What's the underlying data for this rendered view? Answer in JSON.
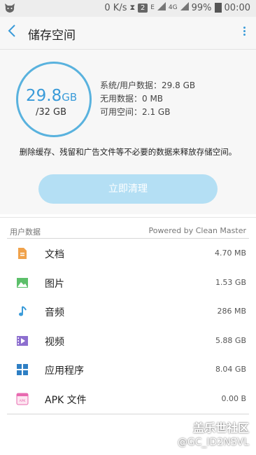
{
  "status_bar": {
    "net_speed": "0 K/s",
    "sim": "2",
    "net_e": "E",
    "net_4g": "4G",
    "battery": "99%",
    "time": "00:00"
  },
  "header": {
    "title": "储存空间"
  },
  "summary": {
    "used": "29.8",
    "used_unit": "GB",
    "total": "/32 GB",
    "stats": [
      "系统/用户数据：29.8 GB",
      "无用数据：0 MB",
      "可用空间：2.1 GB"
    ],
    "description": "删除缓存、残留和广告文件等不必要的数据来释放存储空间。",
    "clean_button": "立即清理"
  },
  "list": {
    "header_label": "用户数据",
    "powered_by": "Powered by Clean Master",
    "items": [
      {
        "name": "文档",
        "size": "4.70 MB",
        "icon": "document-icon",
        "color": "#f0a24b"
      },
      {
        "name": "图片",
        "size": "1.53 GB",
        "icon": "image-icon",
        "color": "#5cbf6a"
      },
      {
        "name": "音频",
        "size": "286 MB",
        "icon": "music-icon",
        "color": "#3a9bd9"
      },
      {
        "name": "视频",
        "size": "5.88 GB",
        "icon": "video-icon",
        "color": "#8d6fcf"
      },
      {
        "name": "应用程序",
        "size": "8.04 GB",
        "icon": "apps-icon",
        "color": "#2e7fc4"
      },
      {
        "name": "APK 文件",
        "size": "0.00 B",
        "icon": "apk-icon",
        "color": "#e86ab0"
      }
    ]
  },
  "watermark": {
    "line1": "盖乐世社区",
    "line2": "@GC_ID2NSVL"
  }
}
